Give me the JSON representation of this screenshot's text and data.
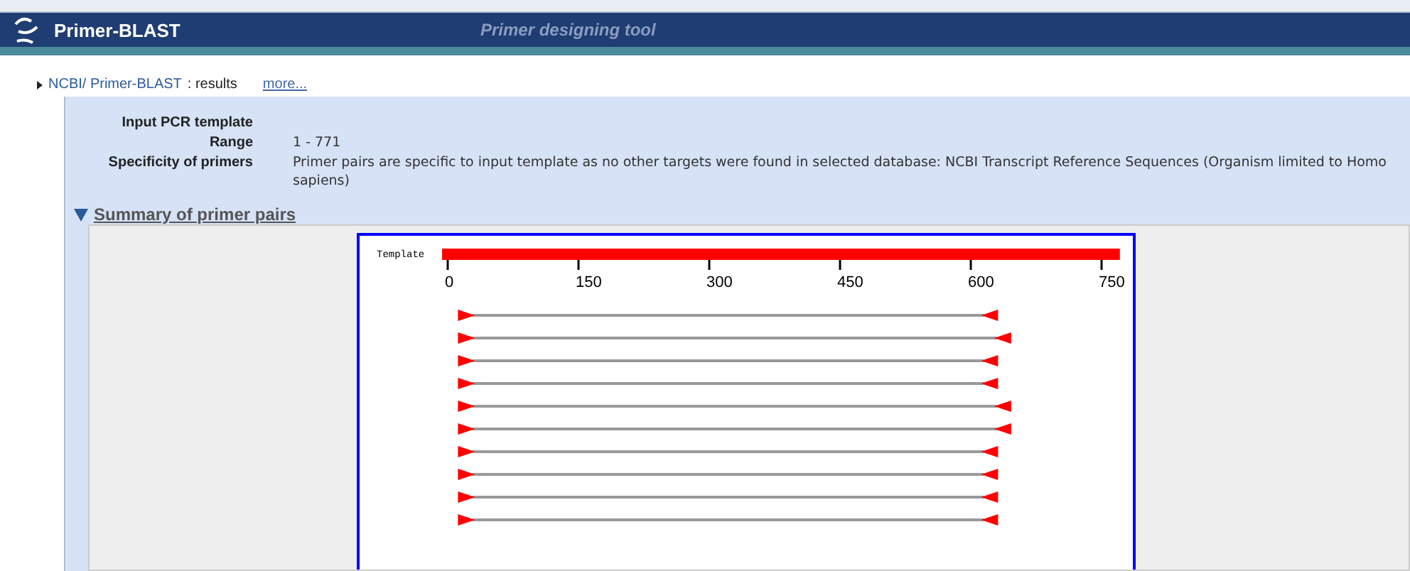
{
  "header": {
    "title": "Primer-BLAST",
    "subtitle": "Primer designing tool"
  },
  "breadcrumb": {
    "link": "NCBI/ Primer-BLAST",
    "suffix": ": results",
    "more": "more..."
  },
  "fields": [
    {
      "label": "Input PCR template"
    },
    {
      "label": "Range",
      "value": "1 - 771"
    },
    {
      "label": "Specificity of primers",
      "value": "Primer pairs are specific to input template as no other targets were found in selected database: NCBI Transcript Reference Sequences (Organism limited to Homo sapiens)"
    }
  ],
  "summary": {
    "title": "Summary of primer pairs",
    "expanded": true,
    "template_label": "Template",
    "ticks": [
      "0",
      "150",
      "300",
      "450",
      "600",
      "750"
    ],
    "primer_pairs": [
      {
        "kind": "short"
      },
      {
        "kind": "long"
      },
      {
        "kind": "short"
      },
      {
        "kind": "short"
      },
      {
        "kind": "long"
      },
      {
        "kind": "long"
      },
      {
        "kind": "short"
      },
      {
        "kind": "short"
      },
      {
        "kind": "short"
      },
      {
        "kind": "short"
      }
    ]
  }
}
